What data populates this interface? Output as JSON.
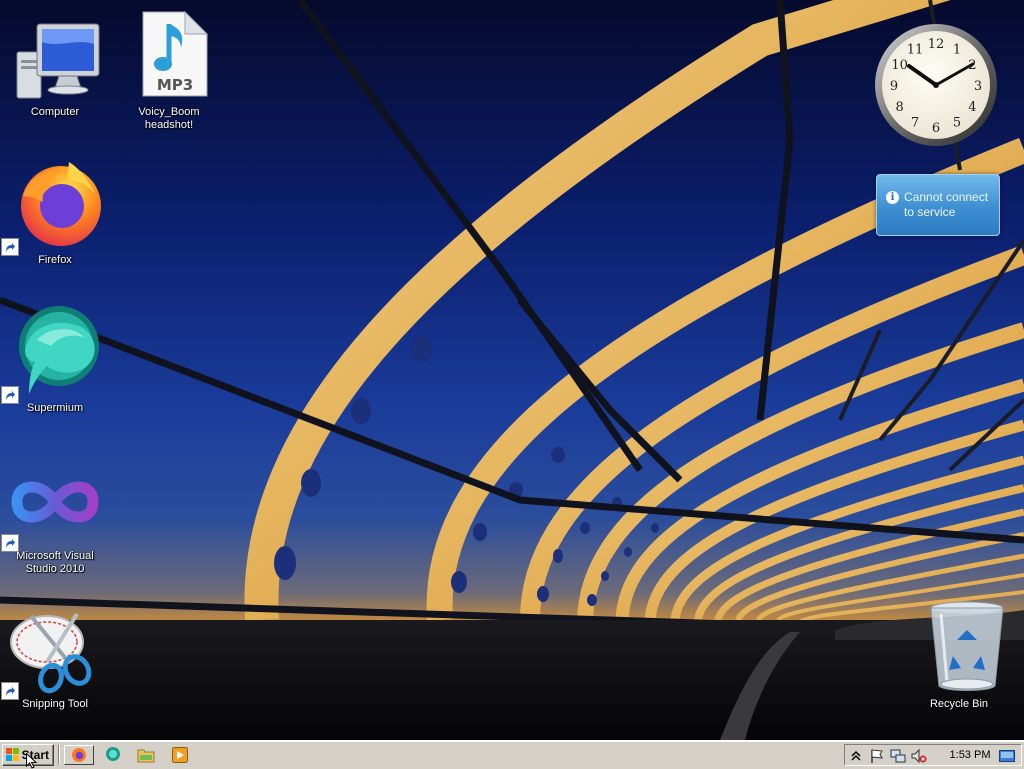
{
  "desktop": {
    "icons": [
      {
        "label": "Computer",
        "icon": "computer-icon"
      },
      {
        "label": "Voicy_Boom headshot!",
        "icon": "mp3-file-icon",
        "badge": "MP3"
      },
      {
        "label": "Firefox",
        "icon": "firefox-icon"
      },
      {
        "label": "Supermium",
        "icon": "supermium-icon"
      },
      {
        "label": "Microsoft Visual Studio 2010",
        "icon": "visual-studio-icon"
      },
      {
        "label": "Snipping Tool",
        "icon": "snipping-tool-icon"
      },
      {
        "label": "Recycle Bin",
        "icon": "recycle-bin-icon"
      }
    ]
  },
  "gadgets": {
    "clock": {
      "hour_numbers": [
        "12",
        "1",
        "2",
        "3",
        "4",
        "5",
        "6",
        "7",
        "8",
        "9",
        "10",
        "11"
      ]
    },
    "weather": {
      "message": "Cannot connect to service",
      "icon": "info-icon"
    }
  },
  "taskbar": {
    "start_label": "Start",
    "quick_launch": [
      "firefox-icon",
      "supermium-icon",
      "explorer-icon",
      "media-player-icon"
    ],
    "tray": {
      "icons": [
        "chevron-up-icon",
        "action-center-flag-icon",
        "network-icon",
        "volume-muted-icon"
      ],
      "time": "1:53 PM"
    }
  },
  "colors": {
    "taskbar": "#d4d0c8",
    "weather_gadget": "#3d8fd2",
    "sky_dark": "#050a2c",
    "bridge_gold": "#e8b860"
  }
}
